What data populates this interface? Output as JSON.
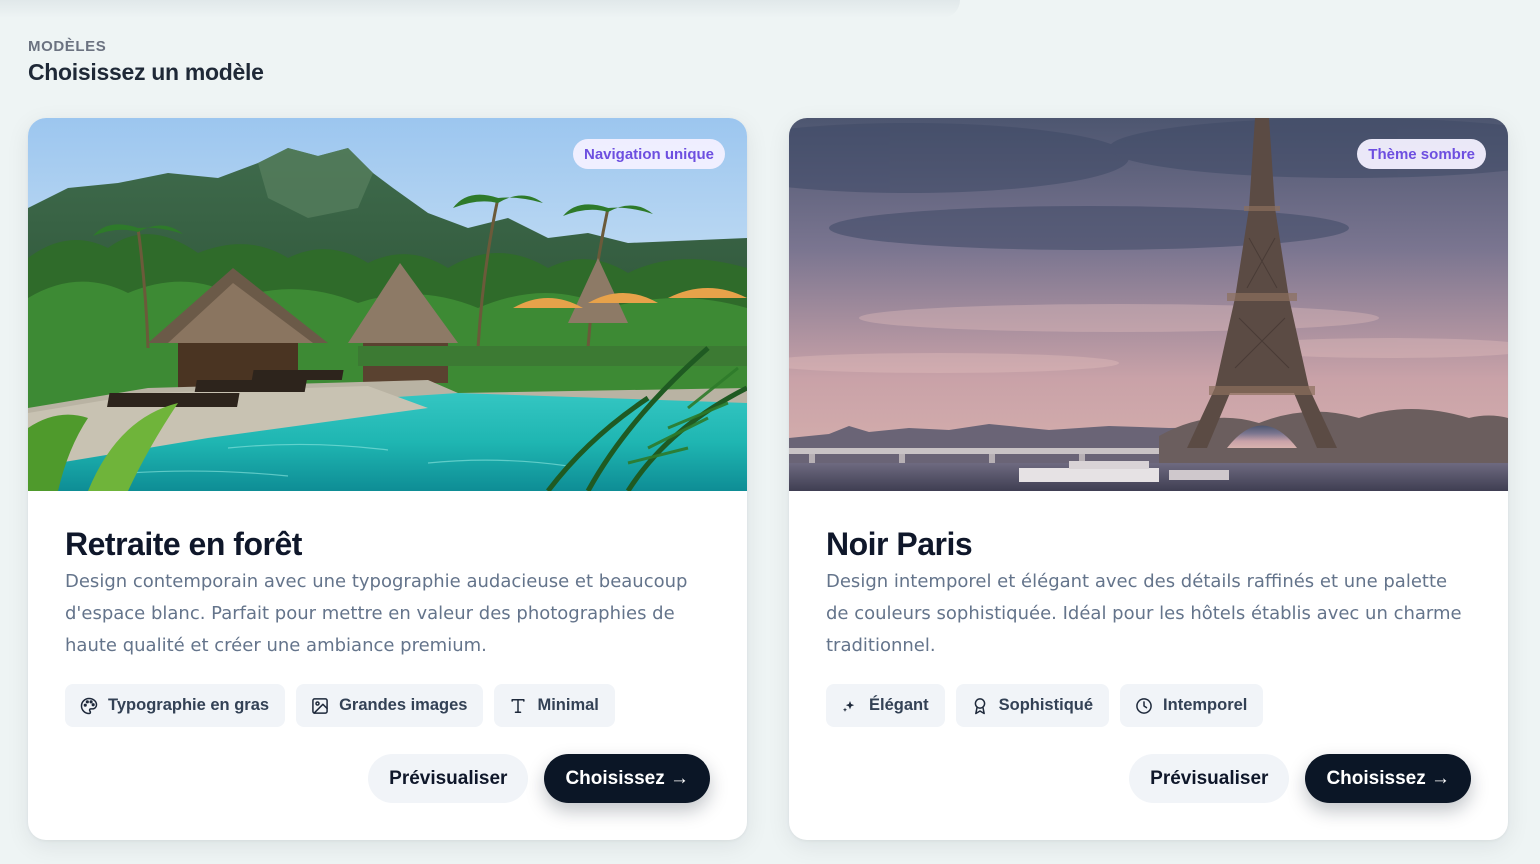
{
  "header": {
    "eyebrow": "MODÈLES",
    "title": "Choisissez un modèle"
  },
  "templates": [
    {
      "badge": "Navigation unique",
      "title": "Retraite en forêt",
      "description": "Design contemporain avec une typographie audacieuse et beaucoup d'espace blanc. Parfait pour mettre en valeur des photographies de haute qualité et créer une ambiance premium.",
      "image": "tropical-resort-pool-photo",
      "tags": [
        {
          "icon": "palette-icon",
          "label": "Typographie en gras"
        },
        {
          "icon": "image-icon",
          "label": "Grandes images"
        },
        {
          "icon": "text-type-icon",
          "label": "Minimal"
        }
      ],
      "preview_label": "Prévisualiser",
      "choose_label": "Choisissez →"
    },
    {
      "badge": "Thème sombre",
      "title": "Noir Paris",
      "description": "Design intemporel et élégant avec des détails raffinés et une palette de couleurs sophistiquée. Idéal pour les hôtels établis avec un charme traditionnel.",
      "image": "eiffel-tower-sunset-photo",
      "tags": [
        {
          "icon": "sparkles-icon",
          "label": "Élégant"
        },
        {
          "icon": "award-icon",
          "label": "Sophistiqué"
        },
        {
          "icon": "clock-icon",
          "label": "Intemporel"
        }
      ],
      "preview_label": "Prévisualiser",
      "choose_label": "Choisissez →"
    }
  ],
  "colors": {
    "background": "#eef4f4",
    "badge_text": "#6d4fe0",
    "primary_button": "#0b1626",
    "tag_background": "#f1f4f8"
  }
}
